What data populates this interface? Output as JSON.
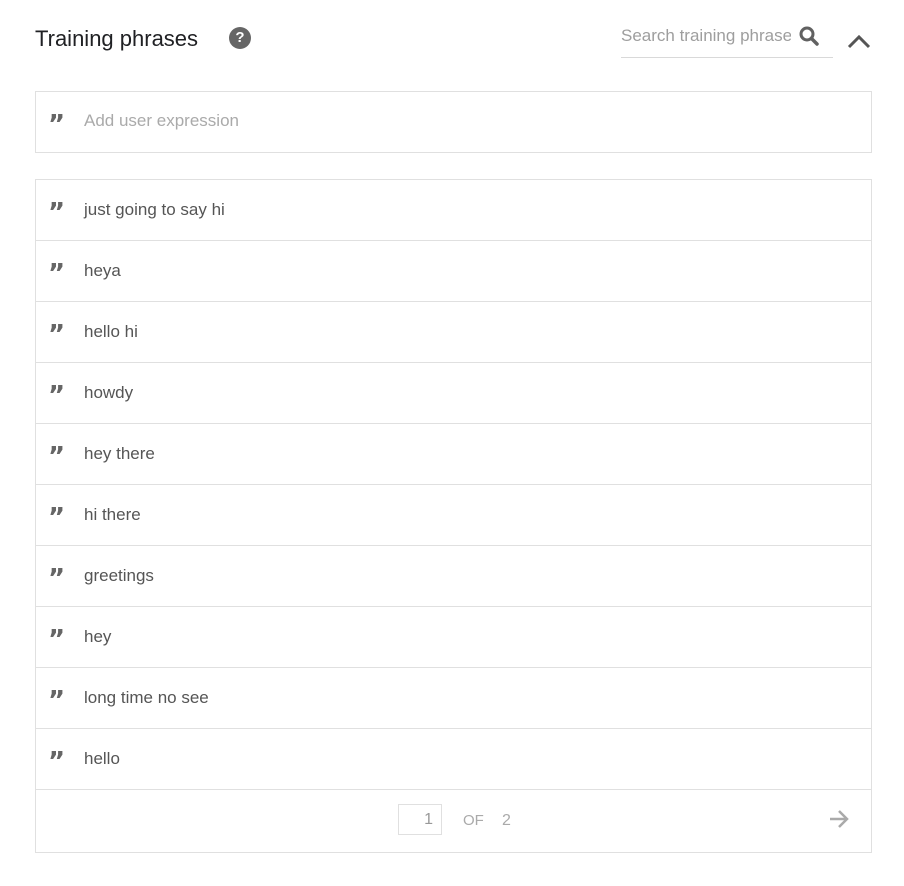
{
  "header": {
    "title": "Training phrases",
    "help_icon": "question-circle-icon",
    "search_placeholder": "Search training phrases",
    "search_icon": "search-icon",
    "collapse_icon": "chevron-up-icon"
  },
  "add_expression": {
    "placeholder": "Add user expression",
    "icon": "quote-icon"
  },
  "phrases": [
    "just going to say hi",
    "heya",
    "hello hi",
    "howdy",
    "hey there",
    "hi there",
    "greetings",
    "hey",
    "long time no see",
    "hello"
  ],
  "pagination": {
    "current_page": "1",
    "of_label": "OF",
    "total_pages": "2",
    "next_icon": "arrow-right-icon"
  }
}
